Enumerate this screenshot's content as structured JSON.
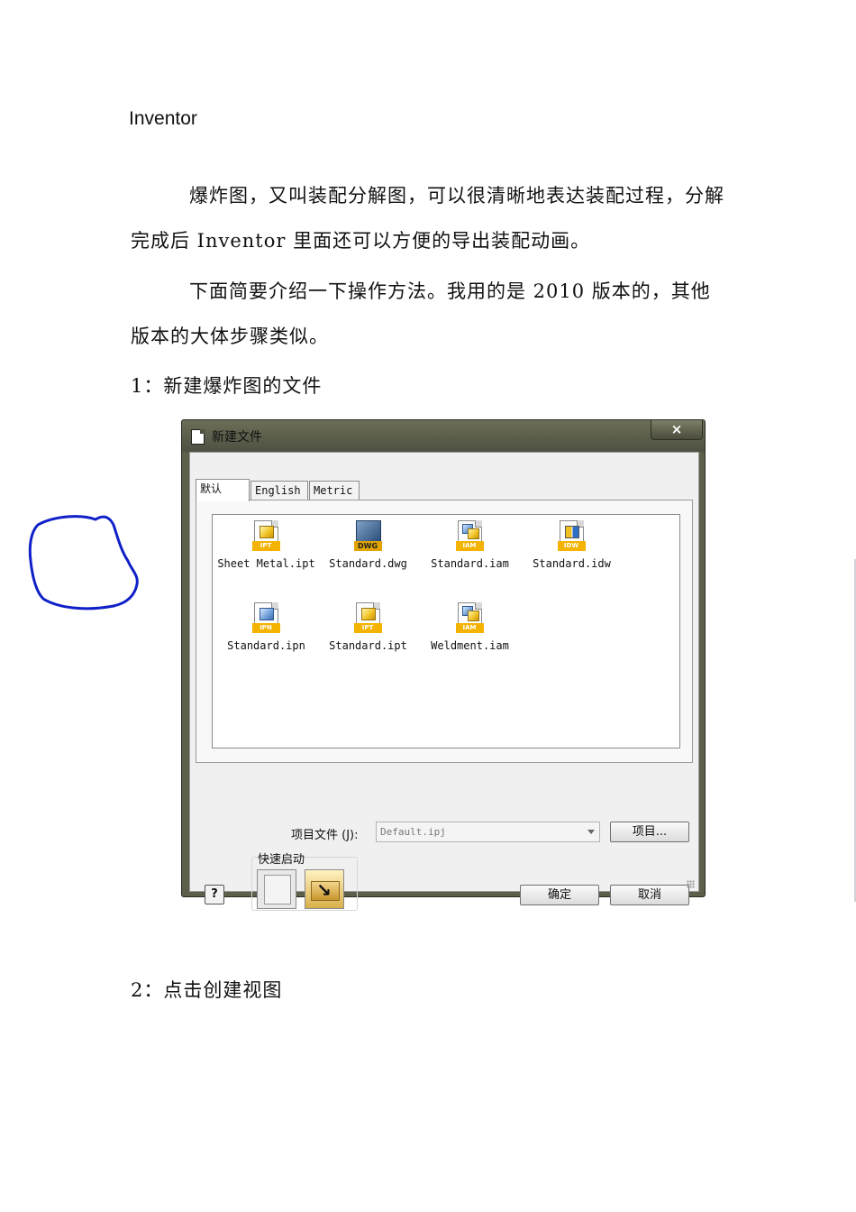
{
  "document": {
    "heading": "Inventor",
    "paragraph1": "爆炸图，又叫装配分解图，可以很清晰地表达装配过程，分解完成后 Inventor 里面还可以方便的导出装配动画。",
    "paragraph2": "下面简要介绍一下操作方法。我用的是 2010 版本的，其他版本的大体步骤类似。",
    "step1": "1：新建爆炸图的文件",
    "step2": "2：点击创建视图"
  },
  "dialog": {
    "title": "新建文件",
    "close": "×",
    "tabs": [
      "默认",
      "English",
      "Metric"
    ],
    "active_tab": "默认",
    "files": [
      {
        "name": "Sheet Metal.ipt",
        "badge": "IPT",
        "icon": "part-file-icon"
      },
      {
        "name": "Standard.dwg",
        "badge": "DWG",
        "icon": "drawing-dwg-file-icon"
      },
      {
        "name": "Standard.iam",
        "badge": "IAM",
        "icon": "assembly-file-icon"
      },
      {
        "name": "Standard.idw",
        "badge": "IDW",
        "icon": "drawing-idw-file-icon"
      },
      {
        "name": "Standard.ipn",
        "badge": "IPN",
        "icon": "presentation-file-icon"
      },
      {
        "name": "Standard.ipt",
        "badge": "IPT",
        "icon": "part-file-icon"
      },
      {
        "name": "Weldment.iam",
        "badge": "IAM",
        "icon": "weldment-file-icon"
      }
    ],
    "highlighted_file": "Standard.ipn",
    "annotation_color": "#1020c8",
    "project_label": "项目文件 (J):",
    "project_value": "Default.ipj",
    "project_button": "项目...",
    "quick_launch_label": "快速启动",
    "ok_button": "确定",
    "cancel_button": "取消",
    "help_button": "?"
  }
}
